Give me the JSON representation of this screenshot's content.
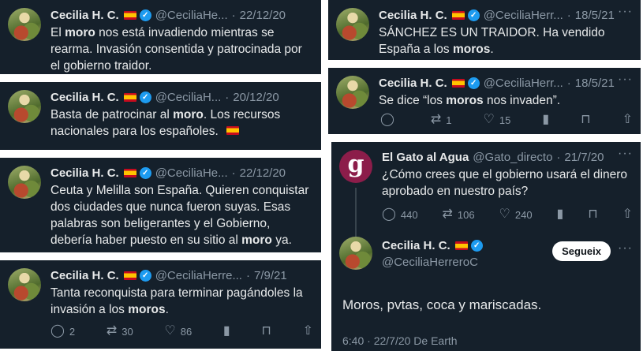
{
  "tweets": [
    {
      "name": "Cecilia H. C.",
      "handle": "@CeciliaHe...",
      "time": "22/12/20",
      "dots": "···",
      "text": [
        [
          "El ",
          ""
        ],
        [
          "moro",
          "b"
        ],
        [
          " nos está invadiendo mientras se rearma. Invasión consentida y patrocinada por el gobierno traidor.",
          ""
        ]
      ]
    },
    {
      "name": "Cecilia H. C.",
      "handle": "@CeciliaH...",
      "time": "20/12/20",
      "dots": "···",
      "text": [
        [
          "Basta de patrocinar al ",
          ""
        ],
        [
          "moro",
          "b"
        ],
        [
          ". Los recursos nacionales para los españoles. ",
          ""
        ]
      ]
    },
    {
      "name": "Cecilia H. C.",
      "handle": "@CeciliaHe...",
      "time": "22/12/20",
      "dots": "···",
      "text": [
        [
          "Ceuta y Melilla son España. Quieren conquistar dos ciudades que nunca fueron suyas. Esas palabras son beligerantes y el Gobierno, debería haber puesto en su sitio al ",
          ""
        ],
        [
          "moro",
          "b"
        ],
        [
          " ya.",
          ""
        ]
      ]
    },
    {
      "name": "Cecilia H. C.",
      "handle": "@CeciliaHerre...",
      "time": "7/9/21",
      "dots": "···",
      "text": [
        [
          "Tanta reconquista para terminar pagándoles la invasión a los ",
          ""
        ],
        [
          "moros",
          "b"
        ],
        [
          ".",
          ""
        ]
      ],
      "actions": {
        "reply": "2",
        "retweet": "30",
        "like": "86"
      }
    },
    {
      "name": "Cecilia H. C.",
      "handle": "@CeciliaHerr...",
      "time": "18/5/21",
      "dots": "···",
      "text": [
        [
          "SÁNCHEZ ES UN TRAIDOR. Ha vendido España a los ",
          ""
        ],
        [
          "moros",
          "b"
        ],
        [
          ".",
          ""
        ]
      ]
    },
    {
      "name": "Cecilia H. C.",
      "handle": "@CeciliaHerr...",
      "time": "18/5/21",
      "dots": "···",
      "text": [
        [
          "Se dice “los ",
          ""
        ],
        [
          "moros",
          "b"
        ],
        [
          " nos invaden”.",
          ""
        ]
      ],
      "actions": {
        "reply": "",
        "retweet": "1",
        "like": "15"
      }
    },
    {
      "name": "El Gato al Agua",
      "handle": "@Gato_directo",
      "time": "21/7/20",
      "dots": "···",
      "logo_letter": "g",
      "text": [
        [
          "¿Cómo crees que el gobierno usará el dinero aprobado en nuestro país?",
          ""
        ]
      ],
      "actions": {
        "reply": "440",
        "retweet": "106",
        "like": "240"
      }
    },
    {
      "name": "Cecilia H. C.",
      "handle": "@CeciliaHerreroC",
      "dots": "···",
      "follow": "Segueix",
      "text": [
        [
          "Moros, pvtas, coca y mariscadas.",
          ""
        ]
      ],
      "timestamp": "6:40 · 22/7/20 De Earth"
    }
  ],
  "colors": {
    "card_bg": "#15202b",
    "verified": "#1d9bf0",
    "muted": "#8b98a5",
    "text": "#e7e9ea",
    "logo": "#8c1d4a"
  },
  "icons": [
    "reply-icon",
    "retweet-icon",
    "like-icon",
    "views-icon",
    "bookmark-icon",
    "share-icon",
    "verified-icon",
    "spain-flag-icon"
  ]
}
